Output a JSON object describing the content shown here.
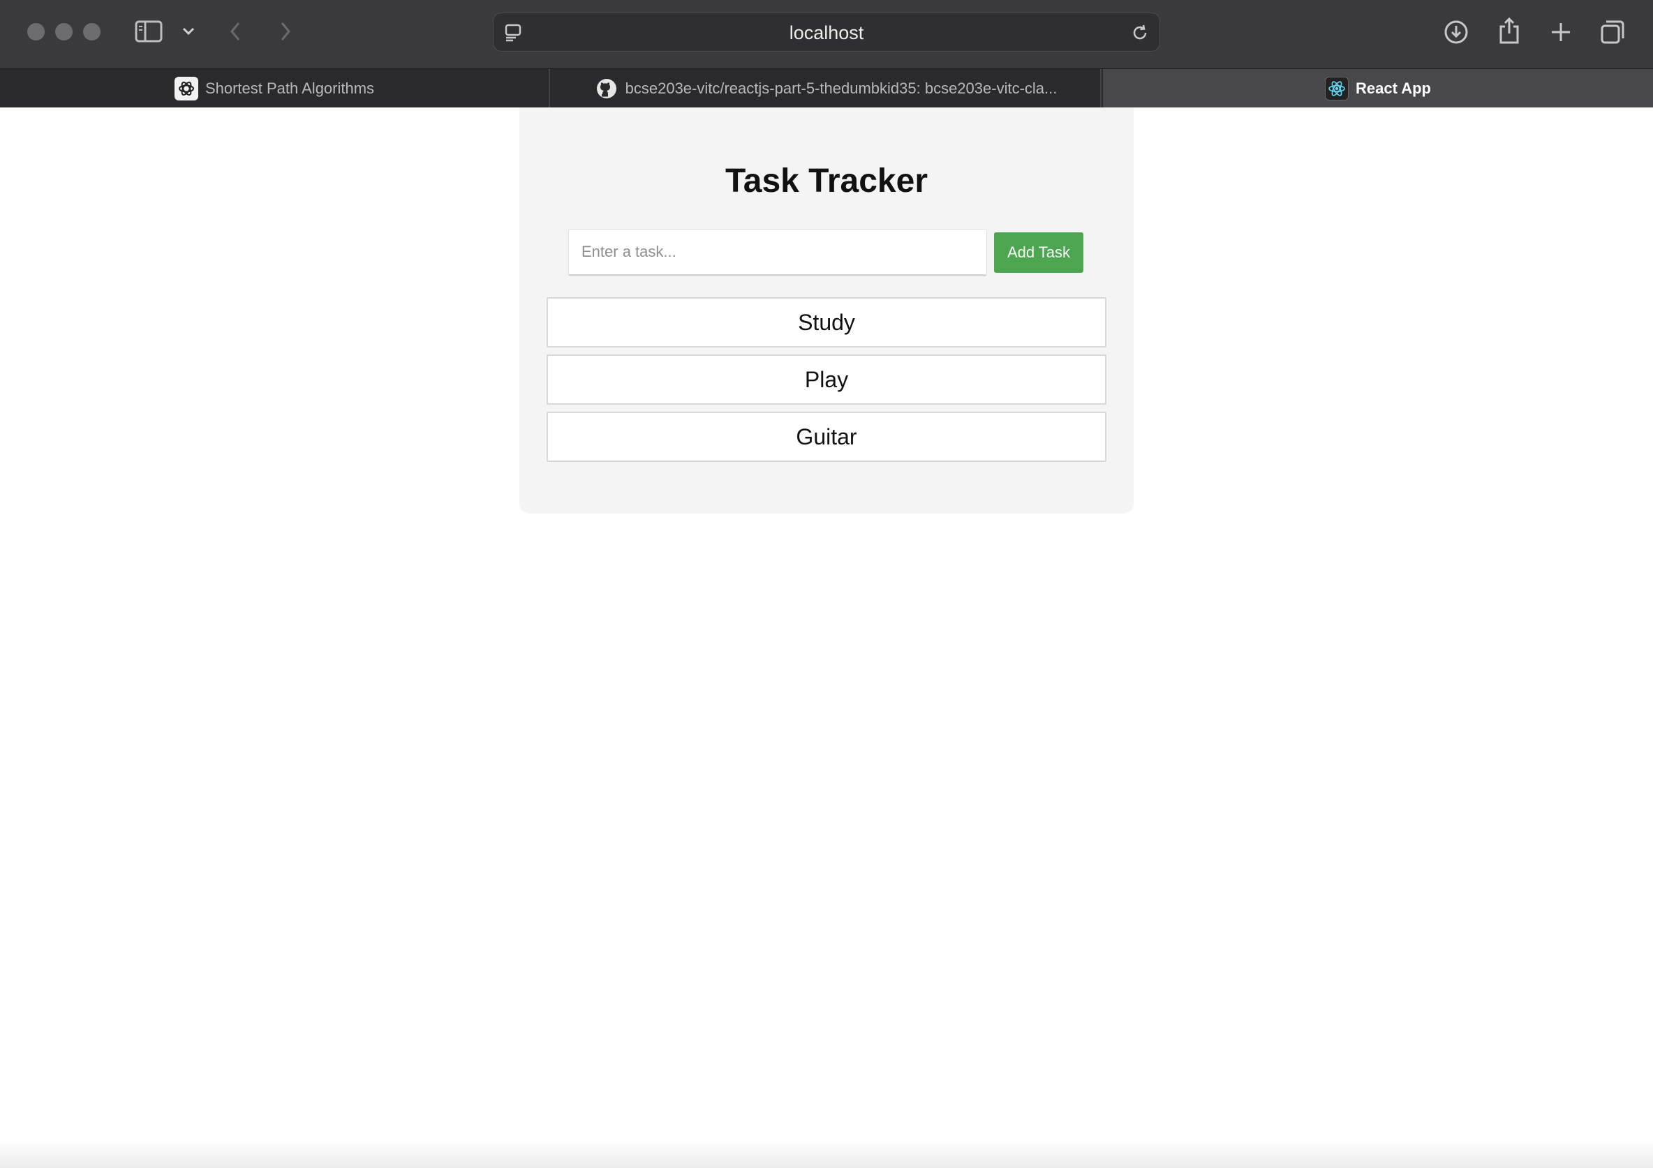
{
  "browser": {
    "address": "localhost",
    "tabs": [
      {
        "label": "Shortest Path Algorithms",
        "icon": "openai-icon",
        "active": false
      },
      {
        "label": "bcse203e-vitc/reactjs-part-5-thedumbkid35: bcse203e-vitc-cla...",
        "icon": "github-icon",
        "active": false
      },
      {
        "label": "React App",
        "icon": "react-icon",
        "active": true
      }
    ]
  },
  "app": {
    "title": "Task Tracker",
    "input_placeholder": "Enter a task...",
    "input_value": "",
    "add_button_label": "Add Task",
    "tasks": [
      "Study",
      "Play",
      "Guitar"
    ]
  },
  "colors": {
    "toolbar": "#3a393c",
    "card_background": "#f4f4f4",
    "add_button": "#4ca54f",
    "react_accent": "#61dafb"
  }
}
